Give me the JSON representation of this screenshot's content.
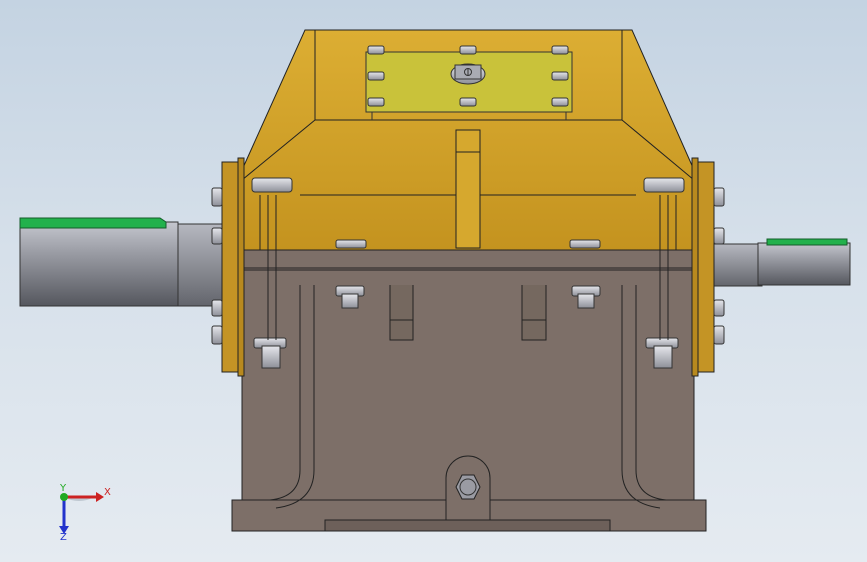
{
  "viewport": {
    "background_top": "#c4d3e2",
    "background_bottom": "#e5ebf1"
  },
  "model": {
    "housing_upper_color": "#d4a42a",
    "housing_lower_color": "#7d6f68",
    "inspection_cover_color": "#c9c23a",
    "shaft_color": "#8c8e96",
    "key_color": "#22b14c"
  },
  "triad": {
    "x_label": "X",
    "y_label": "Y",
    "z_label": "Z",
    "x_color": "#cc2222",
    "y_color": "#22aa22",
    "z_color": "#2233cc"
  }
}
